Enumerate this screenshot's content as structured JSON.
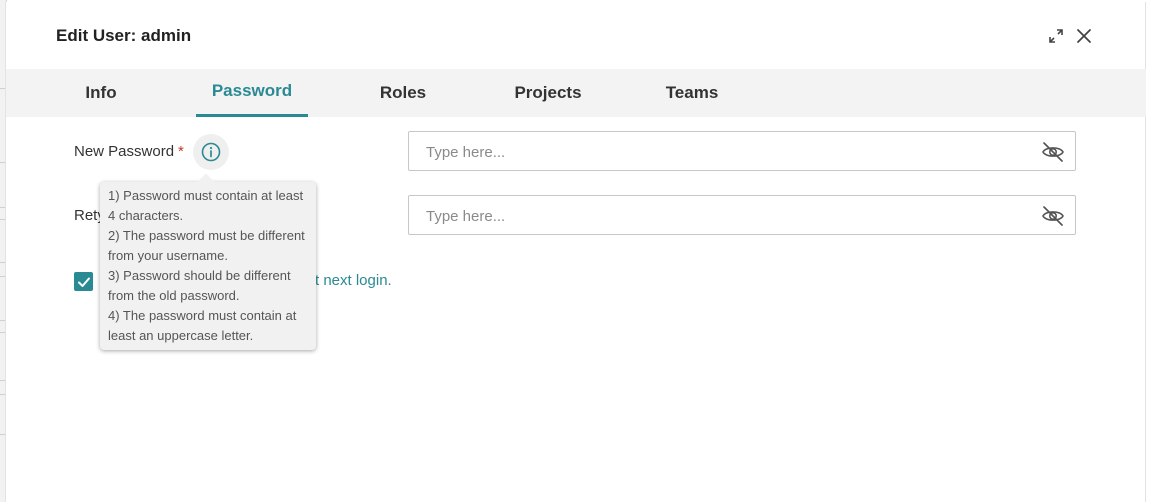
{
  "modal": {
    "title": "Edit User: admin"
  },
  "tabs": [
    {
      "label": "Info"
    },
    {
      "label": "Password"
    },
    {
      "label": "Roles"
    },
    {
      "label": "Projects"
    },
    {
      "label": "Teams"
    }
  ],
  "active_tab": "Password",
  "form": {
    "new_password": {
      "label": "New Password",
      "required_mark": "*",
      "placeholder": "Type here...",
      "value": ""
    },
    "retype_password": {
      "label": "Rety",
      "placeholder": "Type here...",
      "value": ""
    },
    "checkbox": {
      "checked": true,
      "label_visible": "t next login."
    }
  },
  "tooltip": {
    "lines": [
      "1) Password must contain at least 4 characters.",
      "2) The password must be different from your username.",
      "3) Password should be different from the old password.",
      "4) The password must contain at least an uppercase letter."
    ]
  },
  "colors": {
    "accent": "#2a8a93",
    "required": "#c0392b",
    "tab_bar": "#f3f3f3",
    "tooltip_bg": "#f1f1f1"
  },
  "icons": {
    "expand": "expand-icon",
    "close": "close-icon",
    "info": "info-icon",
    "eye_off": "eye-off-icon",
    "check": "check-icon"
  }
}
